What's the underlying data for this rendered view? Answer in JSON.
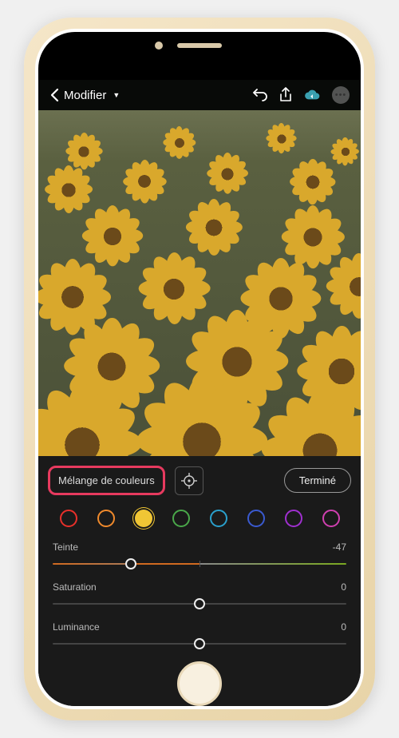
{
  "nav": {
    "title": "Modifier"
  },
  "panel": {
    "colorMixLabel": "Mélange de couleurs",
    "doneLabel": "Terminé",
    "selectedSwatchIndex": 2,
    "swatchColors": [
      "#e8302a",
      "#f08a2c",
      "#f0c635",
      "#4aa84a",
      "#2aa0cc",
      "#3a5ad0",
      "#a030d0",
      "#d040b0"
    ]
  },
  "sliders": {
    "hue": {
      "label": "Teinte",
      "value": -47,
      "min": -100,
      "max": 100,
      "leftColor": "#d06a20",
      "rightColor": "#7aa820"
    },
    "saturation": {
      "label": "Saturation",
      "value": 0,
      "min": -100,
      "max": 100
    },
    "luminance": {
      "label": "Luminance",
      "value": 0,
      "min": -100,
      "max": 100
    }
  }
}
